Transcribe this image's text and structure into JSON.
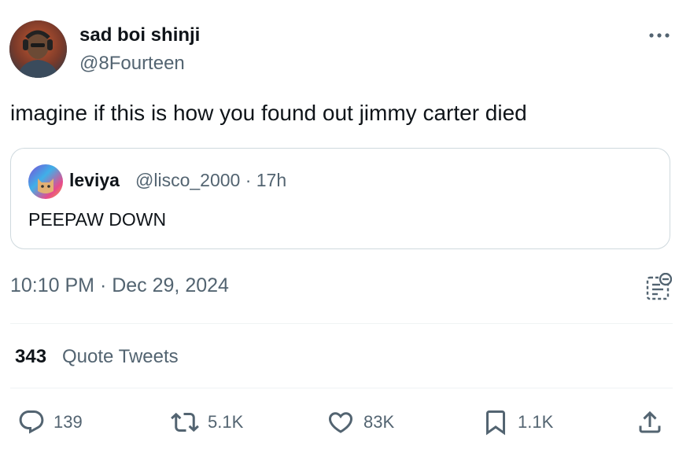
{
  "author": {
    "name": "sad boi shinji",
    "handle": "@8Fourteen"
  },
  "tweet": {
    "text": "imagine if this is how you found out jimmy carter died",
    "timestamp": "10:10 PM · Dec 29, 2024"
  },
  "quoted_tweet": {
    "name": "leviya",
    "handle_and_time": "@lisco_2000 · 17h",
    "text": "PEEPAW DOWN"
  },
  "stats": {
    "quote_tweets_count": "343",
    "quote_tweets_label": "Quote Tweets"
  },
  "actions": {
    "replies": "139",
    "retweets": "5.1K",
    "likes": "83K",
    "bookmarks": "1.1K"
  },
  "icons": {
    "more": "more-horizontal-icon",
    "notes": "community-notes-icon",
    "reply": "reply-bubble-icon",
    "retweet": "retweet-arrows-icon",
    "like": "heart-icon",
    "bookmark": "bookmark-icon",
    "share": "share-upload-icon"
  },
  "colors": {
    "text_primary": "#0f1419",
    "text_secondary": "#536471",
    "border": "#cfd9de",
    "divider": "#eff3f4"
  }
}
